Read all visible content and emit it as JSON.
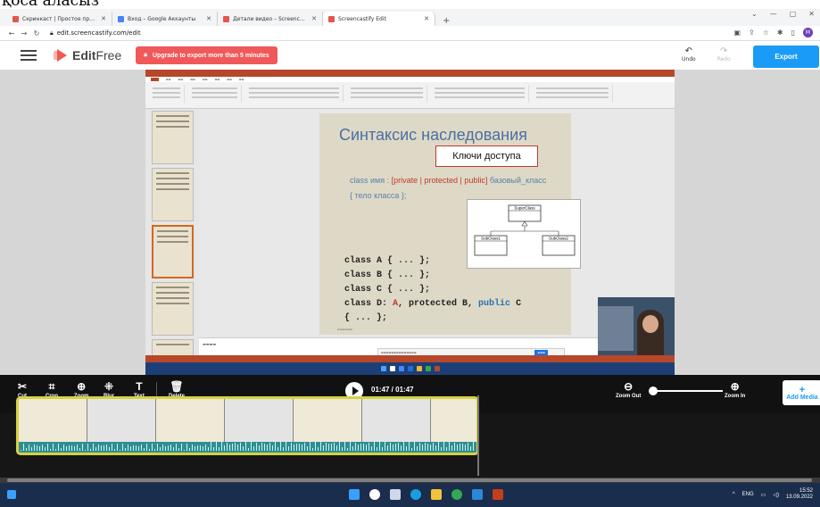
{
  "page_overlay_text": "қоса аласыз",
  "browser": {
    "tabs": [
      {
        "title": "Скринкаст | Простое программ...",
        "color": "#e2574c"
      },
      {
        "title": "Вход – Google Аккаунты",
        "color": "#4285f4"
      },
      {
        "title": "Детали видео – Screencastify",
        "color": "#e2574c"
      },
      {
        "title": "Screencastify Edit",
        "color": "#e2574c",
        "active": true
      }
    ],
    "url": "edit.screencastify.com/edit",
    "profile_initial": "M"
  },
  "app": {
    "logo_bold": "Edit",
    "logo_light": "Free",
    "upgrade_label": "Upgrade to export more than 5 minutes",
    "undo_label": "Undo",
    "redo_label": "Redo",
    "export_label": "Export",
    "accent_color": "#1a9bf5"
  },
  "slide": {
    "title": "Синтаксис наследования",
    "callout": "Ключи доступа",
    "syntax_prefix": "class имя : ",
    "syntax_access": "[private | protected | public]",
    "syntax_suffix": " базовый_класс",
    "syntax_body": "{ тело класса };",
    "uml_superclass": "SuperClass",
    "uml_subclass1": "SubClass1",
    "uml_subclass2": "SubClass2",
    "code_lines": [
      "class A { ... };",
      "class B { ... };",
      "class C { ... };"
    ],
    "code_d_prefix": "class D: ",
    "code_d_a": "A",
    "code_d_mid": ", protected B, ",
    "code_d_public": "public",
    "code_d_suffix": " C",
    "code_d_body": "{ ... };"
  },
  "toolbar": {
    "cut_label": "Cut",
    "crop_label": "Crop",
    "zoom_label": "Zoom",
    "blur_label": "Blur",
    "text_label": "Text",
    "delete_label": "Delete",
    "timecode": "01:47 / 01:47",
    "zoom_out_label": "Zoom Out",
    "zoom_in_label": "Zoom In",
    "add_media_label": "Add Media"
  },
  "taskbar": {
    "lang": "ENG",
    "time": "15:52",
    "date": "13.09.2022"
  }
}
